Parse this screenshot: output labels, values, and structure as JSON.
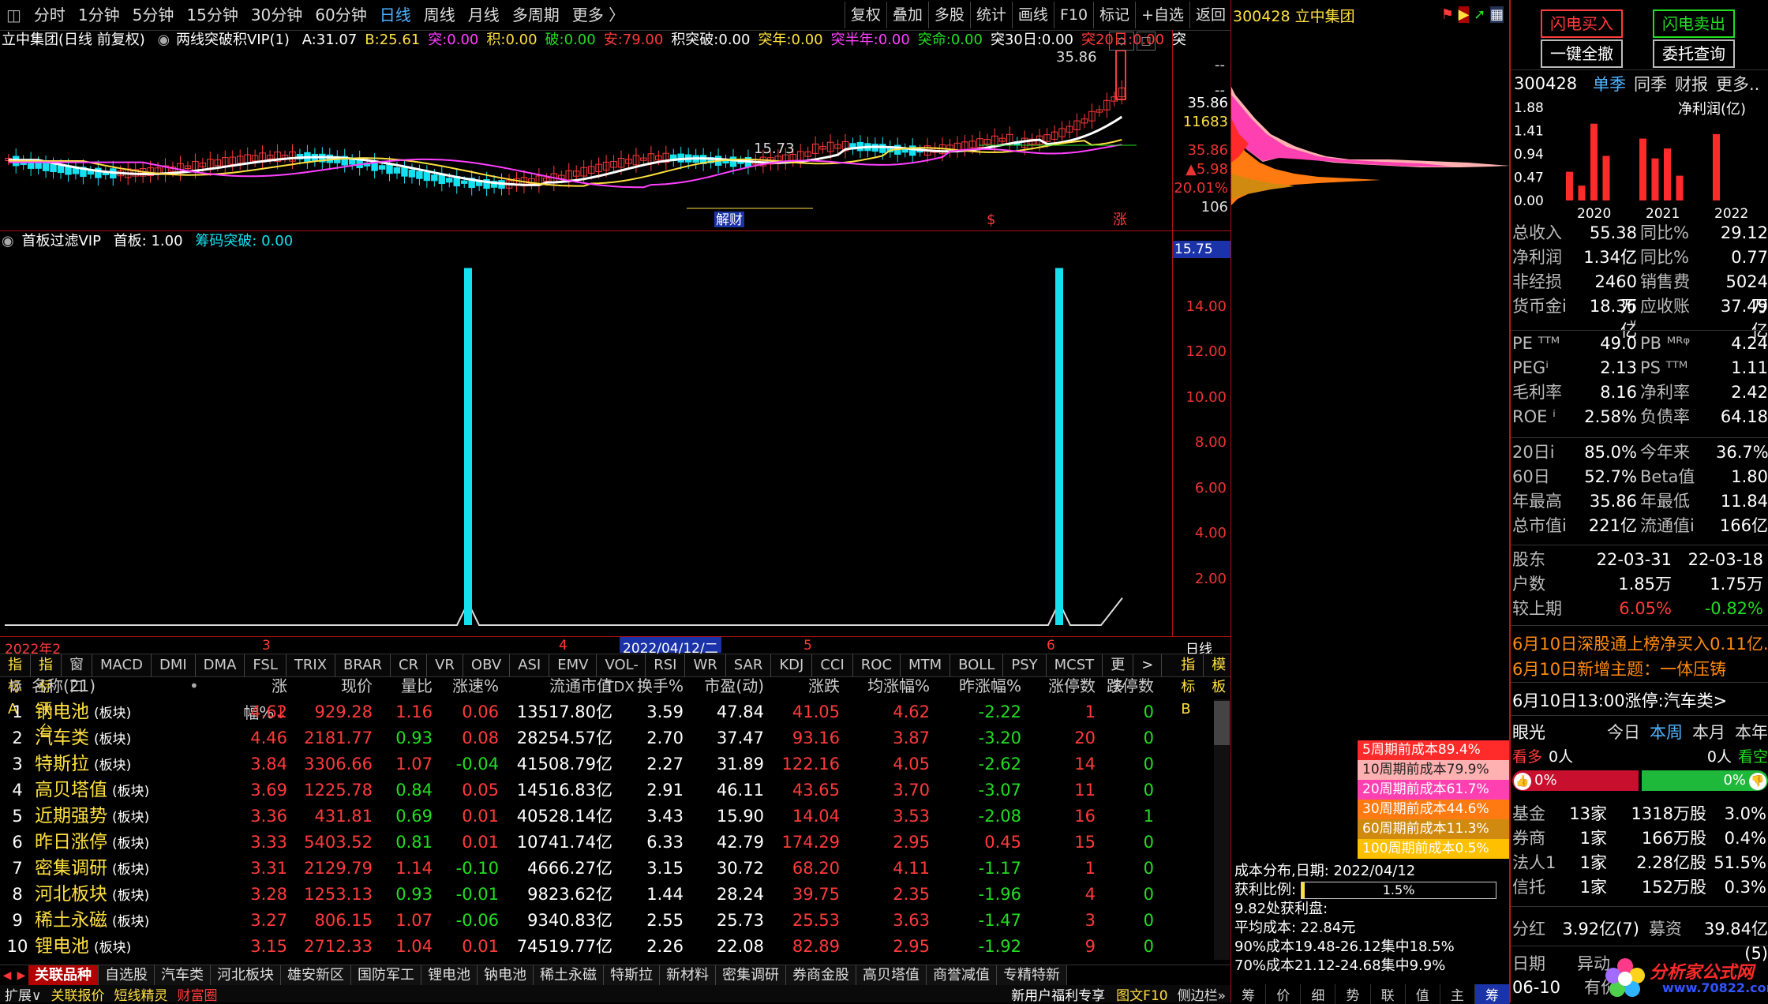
{
  "toolbar": {
    "periods": [
      "分时",
      "1分钟",
      "5分钟",
      "15分钟",
      "30分钟",
      "60分钟",
      "日线",
      "周线",
      "月线",
      "多周期",
      "更多"
    ],
    "active_period": "日线",
    "right_buttons": [
      "复权",
      "叠加",
      "多股",
      "统计",
      "画线",
      "F10",
      "标记",
      "+自选",
      "返回"
    ]
  },
  "chart_header": {
    "stock": "立中集团(日线 前复权)",
    "indicator": "两线突破积VIP(1)",
    "items": [
      {
        "label": "A:",
        "value": "31.07",
        "color": "#ffffff"
      },
      {
        "label": "B:",
        "value": "25.61",
        "color": "#ffe040"
      },
      {
        "label": "突:",
        "value": "0.00",
        "color": "#ff40ff"
      },
      {
        "label": "积:",
        "value": "0.00",
        "color": "#ffe040"
      },
      {
        "label": "破:",
        "value": "0.00",
        "color": "#22dd22"
      },
      {
        "label": "安:",
        "value": "79.00",
        "color": "#ff3a3a"
      },
      {
        "label": "积突破:",
        "value": "0.00",
        "color": "#ffffff"
      },
      {
        "label": "突年:",
        "value": "0.00",
        "color": "#ffe040"
      },
      {
        "label": "突半年:",
        "value": "0.00",
        "color": "#ff40ff"
      },
      {
        "label": "突命:",
        "value": "0.00",
        "color": "#22dd22"
      },
      {
        "label": "突30日:",
        "value": "0.00",
        "color": "#ffffff"
      },
      {
        "label": "突20日:",
        "value": "0.00",
        "color": "#ff3a3a"
      },
      {
        "label": "突",
        "value": "",
        "color": "#ffffff"
      }
    ]
  },
  "price_axis": {
    "dashes": [
      "--",
      "--"
    ],
    "high": "35.86",
    "volume_like": "11683",
    "price": "35.86",
    "change": "▲5.98",
    "pct": "20.01%",
    "low": "106"
  },
  "chart_labels": {
    "peak": "35.86",
    "trough": "15.73",
    "news_tag": "解财",
    "zhang": "涨",
    "dollar": "$"
  },
  "indicator2": {
    "name": "首板过滤VIP",
    "label1": "首板: 1.00",
    "label2": "筹码突破: 0.00",
    "current": "15.75",
    "ticks": [
      "14.00",
      "12.00",
      "10.00",
      "8.00",
      "6.00",
      "4.00",
      "2.00"
    ]
  },
  "date_axis": {
    "labels": [
      "2022年2",
      "3",
      "4",
      "5",
      "6"
    ],
    "highlight": "2022/04/12/二",
    "period": "日线"
  },
  "indicator_tabs": [
    "指标A",
    "指标平台",
    "窗口",
    "MACD",
    "DMI",
    "DMA",
    "FSL",
    "TRIX",
    "BRAR",
    "CR",
    "VR",
    "OBV",
    "ASI",
    "EMV",
    "VOL-TDX",
    "RSI",
    "WR",
    "SAR",
    "KDJ",
    "CCI",
    "ROC",
    "MTM",
    "BOLL",
    "PSY",
    "MCST",
    "更多",
    ">",
    "指标B",
    "模板",
    "+",
    "-"
  ],
  "table": {
    "headers": [
      "名称(21)",
      "涨幅%",
      "现价",
      "量比",
      "涨速%",
      "流通市值",
      "换手%",
      "市盈(动)",
      "涨跌",
      "均涨幅%",
      "昨涨幅%",
      "涨停数",
      "跌停数"
    ],
    "rows": [
      {
        "no": "1",
        "name": "钠电池",
        "tag": "(板块)",
        "pct": "4.62",
        "price": "929.28",
        "lb": "1.16",
        "speed": "0.06",
        "mcap": "13517.80亿",
        "turn": "3.59",
        "pe": "47.84",
        "chg": "41.05",
        "avg": "4.62",
        "yest": "-2.22",
        "up": "1",
        "down": "0"
      },
      {
        "no": "2",
        "name": "汽车类",
        "tag": "(板块)",
        "pct": "4.46",
        "price": "2181.77",
        "lb": "0.93",
        "speed": "0.08",
        "mcap": "28254.57亿",
        "turn": "2.70",
        "pe": "37.47",
        "chg": "93.16",
        "avg": "3.87",
        "yest": "-3.20",
        "up": "20",
        "down": "0"
      },
      {
        "no": "3",
        "name": "特斯拉",
        "tag": "(板块)",
        "pct": "3.84",
        "price": "3306.66",
        "lb": "1.07",
        "speed": "-0.04",
        "mcap": "41508.79亿",
        "turn": "2.27",
        "pe": "31.89",
        "chg": "122.16",
        "avg": "4.05",
        "yest": "-2.62",
        "up": "14",
        "down": "0"
      },
      {
        "no": "4",
        "name": "高贝塔值",
        "tag": "(板块)",
        "pct": "3.69",
        "price": "1225.78",
        "lb": "0.84",
        "speed": "0.05",
        "mcap": "14516.83亿",
        "turn": "2.91",
        "pe": "46.11",
        "chg": "43.65",
        "avg": "3.70",
        "yest": "-3.07",
        "up": "11",
        "down": "0"
      },
      {
        "no": "5",
        "name": "近期强势",
        "tag": "(板块)",
        "pct": "3.36",
        "price": "431.81",
        "lb": "0.69",
        "speed": "0.01",
        "mcap": "40528.14亿",
        "turn": "3.43",
        "pe": "15.90",
        "chg": "14.04",
        "avg": "3.53",
        "yest": "-2.08",
        "up": "16",
        "down": "1"
      },
      {
        "no": "6",
        "name": "昨日涨停",
        "tag": "(板块)",
        "pct": "3.33",
        "price": "5403.52",
        "lb": "0.81",
        "speed": "0.01",
        "mcap": "10741.74亿",
        "turn": "6.33",
        "pe": "42.79",
        "chg": "174.29",
        "avg": "2.95",
        "yest": "0.45",
        "up": "15",
        "down": "0"
      },
      {
        "no": "7",
        "name": "密集调研",
        "tag": "(板块)",
        "pct": "3.31",
        "price": "2129.79",
        "lb": "1.14",
        "speed": "-0.10",
        "mcap": "4666.27亿",
        "turn": "3.15",
        "pe": "30.72",
        "chg": "68.20",
        "avg": "4.11",
        "yest": "-1.17",
        "up": "1",
        "down": "0"
      },
      {
        "no": "8",
        "name": "河北板块",
        "tag": "(板块)",
        "pct": "3.28",
        "price": "1253.13",
        "lb": "0.93",
        "speed": "-0.01",
        "mcap": "9823.62亿",
        "turn": "1.44",
        "pe": "28.24",
        "chg": "39.75",
        "avg": "2.35",
        "yest": "-1.96",
        "up": "4",
        "down": "0"
      },
      {
        "no": "9",
        "name": "稀土永磁",
        "tag": "(板块)",
        "pct": "3.27",
        "price": "806.15",
        "lb": "1.07",
        "speed": "-0.06",
        "mcap": "9340.83亿",
        "turn": "2.55",
        "pe": "25.73",
        "chg": "25.53",
        "avg": "3.63",
        "yest": "-1.47",
        "up": "3",
        "down": "0"
      },
      {
        "no": "10",
        "name": "锂电池",
        "tag": "(板块)",
        "pct": "3.15",
        "price": "2712.33",
        "lb": "1.04",
        "speed": "0.01",
        "mcap": "74519.77亿",
        "turn": "2.26",
        "pe": "22.08",
        "chg": "82.89",
        "avg": "2.95",
        "yest": "-1.92",
        "up": "9",
        "down": "0"
      }
    ]
  },
  "category_tabs": [
    "关联品种",
    "自选股",
    "汽车类",
    "河北板块",
    "雄安新区",
    "国防军工",
    "锂电池",
    "钠电池",
    "稀土永磁",
    "特斯拉",
    "新材料",
    "密集调研",
    "券商金股",
    "高贝塔值",
    "商誉减值",
    "专精特新"
  ],
  "status_bar": [
    "扩展∨",
    "关联报价",
    "短线精灵",
    "财富圈"
  ],
  "status_news": "新用户福利专享",
  "status_right": [
    "图文F10",
    "侧边栏»"
  ],
  "distribution": {
    "title": "300428 立中集团",
    "legend": [
      {
        "text": "5周期前成本89.4%",
        "bg": "#ff2a2a"
      },
      {
        "text": "10周期前成本79.9%",
        "bg": "#ffb0b0"
      },
      {
        "text": "20周期前成本61.7%",
        "bg": "#ff40b0"
      },
      {
        "text": "30周期前成本44.6%",
        "bg": "#ff7a10"
      },
      {
        "text": "60周期前成本11.3%",
        "bg": "#d08a10"
      },
      {
        "text": "100周期前成本0.5%",
        "bg": "#ffc000"
      }
    ],
    "info": [
      "成本分布,日期: 2022/04/12",
      "获利比例:",
      "9.82处获利盘:",
      "平均成本: 22.84元",
      "90%成本19.48-26.12集中18.5%",
      "70%成本21.12-24.68集中9.9%"
    ],
    "profit_ratio": "1.5%",
    "profit_fill": 0.015,
    "bottom_tabs": [
      "筹",
      "价",
      "细",
      "势",
      "联",
      "值",
      "主",
      "筹"
    ]
  },
  "side": {
    "buy": "闪电买入",
    "sell": "闪电卖出",
    "cancel_all": "一键全撤",
    "order_query": "委托查询",
    "code": "300428",
    "tabs": [
      "单季",
      "同季",
      "财报",
      "更多.."
    ],
    "active_tab": "单季",
    "chart_title": "净利润(亿)",
    "chart_data": {
      "type": "bar",
      "title": "净利润(亿)",
      "categories": [
        "2020",
        "",
        "",
        "",
        "",
        "2021",
        "",
        "",
        "",
        "",
        "",
        "2022",
        ""
      ],
      "values": [
        0.58,
        0.3,
        1.55,
        0.9,
        0.0,
        0.0,
        1.25,
        0.85,
        1.05,
        0.5,
        0.0,
        0.0,
        1.34
      ],
      "ylim": [
        0,
        1.88
      ],
      "ticks": [
        "1.88",
        "1.41",
        "0.94",
        "0.47",
        "0.00"
      ],
      "xlabels": [
        "2020",
        "2021",
        "2022"
      ]
    },
    "fin": [
      {
        "k": "总收入",
        "v": "55.38亿",
        "k2": "同比%",
        "v2": "29.12"
      },
      {
        "k": "净利润",
        "v": "1.34亿",
        "k2": "同比%",
        "v2": "0.77"
      },
      {
        "k": "非经损",
        "v": "2460万",
        "k2": "销售费",
        "v2": "5024万"
      },
      {
        "k": "货币金i",
        "v": "18.36亿",
        "k2": "应收账",
        "v2": "37.49亿"
      }
    ],
    "val": [
      {
        "k": "PE ᵀᵀᴹ",
        "v": "49.0",
        "k2": "PB ᴹᴿᵠ",
        "v2": "4.24"
      },
      {
        "k": "PEGⁱ",
        "v": "2.13",
        "k2": "PS ᵀᵀᴹ",
        "v2": "1.11"
      },
      {
        "k": "毛利率",
        "v": "8.16",
        "k2": "净利率",
        "v2": "2.42"
      },
      {
        "k": "ROE ⁱ",
        "v": "2.58%",
        "k2": "负债率",
        "v2": "64.18"
      }
    ],
    "perf": [
      {
        "k": "20日i",
        "v": "85.0%",
        "k2": "今年来",
        "v2": "36.7%"
      },
      {
        "k": "60日",
        "v": "52.7%",
        "k2": "Beta值",
        "v2": "1.80"
      },
      {
        "k": "年最高",
        "v": "35.86",
        "k2": "年最低",
        "v2": "11.84"
      },
      {
        "k": "总市值i",
        "v": "221亿",
        "k2": "流通值i",
        "v2": "166亿"
      }
    ],
    "holders": [
      {
        "k": "股东",
        "v": "22-03-31",
        "v2": "22-03-18"
      },
      {
        "k": "户数",
        "v": "1.85万",
        "v2": "1.75万"
      },
      {
        "k": "较上期",
        "v": "6.05%",
        "v2": "-0.82%"
      }
    ],
    "news": [
      "6月10日深股通上榜净买入0.11亿...",
      "6月10日新增主题：一体压铸",
      "6月10日13:00涨停:汽车类>"
    ],
    "eye": {
      "title": "眼光",
      "periods": [
        "今日",
        "本周",
        "本月",
        "本年"
      ],
      "active": "本周",
      "bull": "看多",
      "bull_n": "0人",
      "bear_n": "0人",
      "bear": "看空",
      "bull_pct": "0%",
      "bear_pct": "0%"
    },
    "inst": [
      {
        "k": "基金",
        "n": "13家",
        "s": "1318万股",
        "p": "3.0%"
      },
      {
        "k": "券商",
        "n": "1家",
        "s": "166万股",
        "p": "0.4%"
      },
      {
        "k": "法人1",
        "n": "1家",
        "s": "2.28亿股",
        "p": "51.5%"
      },
      {
        "k": "信托",
        "n": "1家",
        "s": "152万股",
        "p": "0.3%"
      }
    ],
    "dividend": {
      "k": "分红",
      "v": "3.92亿(7)",
      "k2": "募资",
      "v2": "39.84亿(5)"
    },
    "bottom": {
      "date_k": "日期",
      "date_v": "06-10",
      "move": "异动",
      "have": "有价"
    },
    "watermark": "分析家公式网",
    "watermark_url": "www.70822.com"
  }
}
